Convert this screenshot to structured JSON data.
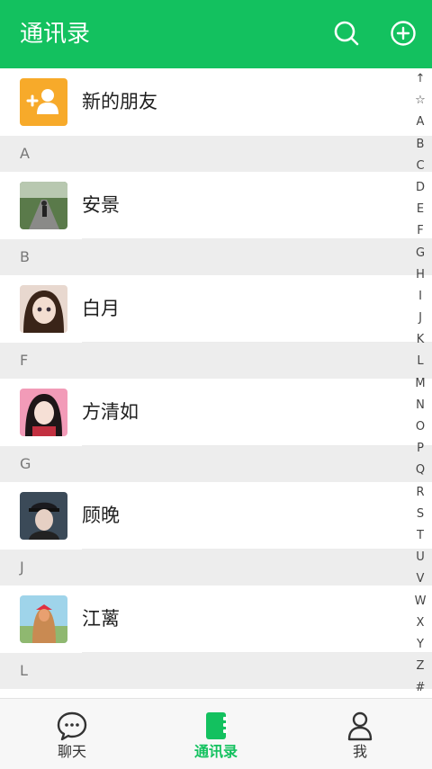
{
  "header": {
    "title": "通讯录",
    "accent": "#13c15f"
  },
  "new_friends": {
    "label": "新的朋友"
  },
  "sections": [
    {
      "letter": "A",
      "contacts": [
        {
          "name": "安景"
        }
      ]
    },
    {
      "letter": "B",
      "contacts": [
        {
          "name": "白月"
        }
      ]
    },
    {
      "letter": "F",
      "contacts": [
        {
          "name": "方清如"
        }
      ]
    },
    {
      "letter": "G",
      "contacts": [
        {
          "name": "顾晚"
        }
      ]
    },
    {
      "letter": "J",
      "contacts": [
        {
          "name": "江蓠"
        }
      ]
    },
    {
      "letter": "L",
      "contacts": [
        {
          "name": ""
        }
      ]
    }
  ],
  "index_letters": [
    "↑",
    "☆",
    "A",
    "B",
    "C",
    "D",
    "E",
    "F",
    "G",
    "H",
    "I",
    "J",
    "K",
    "L",
    "M",
    "N",
    "O",
    "P",
    "Q",
    "R",
    "S",
    "T",
    "U",
    "V",
    "W",
    "X",
    "Y",
    "Z",
    "#"
  ],
  "tabs": [
    {
      "label": "聊天",
      "icon": "chat-bubble-icon"
    },
    {
      "label": "通讯录",
      "icon": "contacts-book-icon",
      "active": true
    },
    {
      "label": "我",
      "icon": "person-icon"
    }
  ]
}
